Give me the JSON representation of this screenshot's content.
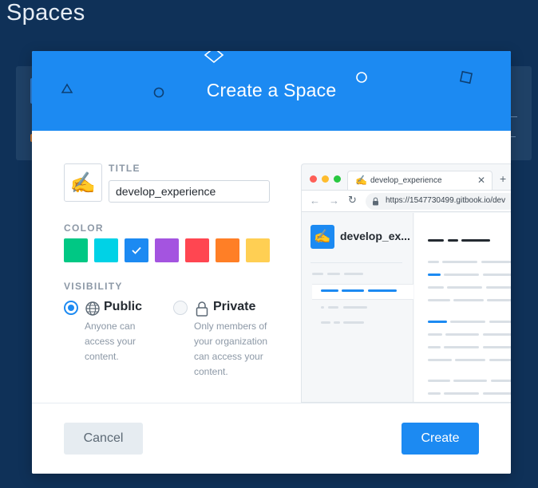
{
  "page": {
    "title": "Spaces"
  },
  "modal": {
    "title": "Create a Space",
    "emoji": "✍️",
    "title_label": "TITLE",
    "title_value": "develop_experience",
    "color_label": "COLOR",
    "colors": [
      "#00c884",
      "#00d2e6",
      "#1c8af2",
      "#a454e0",
      "#ff4651",
      "#ff7f26",
      "#ffcf53"
    ],
    "selected_color_index": 2,
    "visibility_label": "VISIBILITY",
    "visibility": {
      "public": {
        "label": "Public",
        "desc_lines": [
          "Anyone can",
          "access your",
          "content."
        ],
        "selected": true
      },
      "private": {
        "label": "Private",
        "desc_lines": [
          "Only members of",
          "your organization",
          "can access your",
          "content."
        ],
        "selected": false
      }
    },
    "preview": {
      "tab_title": "develop_experience",
      "url": "https://1547730499.gitbook.io/dev",
      "space_name": "develop_ex..."
    },
    "cancel_label": "Cancel",
    "create_label": "Create"
  },
  "colors": {
    "primary": "#1c8af2",
    "background": "#0f3158"
  }
}
